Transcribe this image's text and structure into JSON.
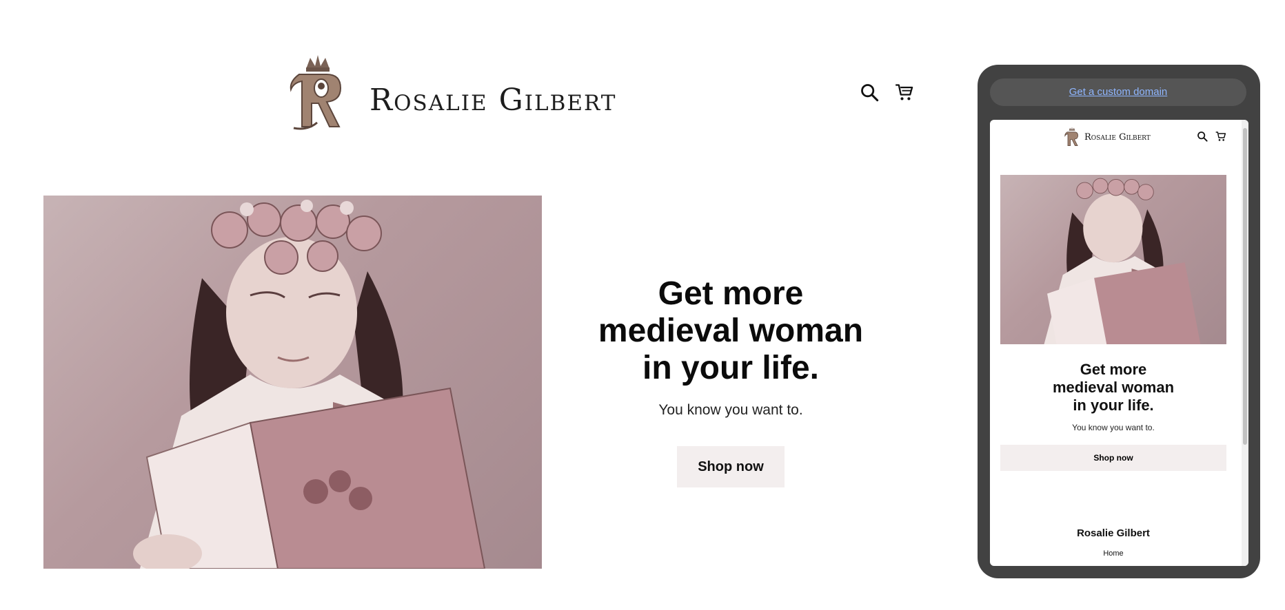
{
  "site": {
    "brand": "Rosalie Gilbert",
    "icons": {
      "search": "search-icon",
      "cart": "cart-icon",
      "monogram": "r-monogram-crown-icon"
    }
  },
  "hero": {
    "title_lines": [
      "Get more",
      "medieval woman",
      "in your life."
    ],
    "subtitle": "You know you want to.",
    "button_label": "Shop now"
  },
  "phone_preview": {
    "domain_link": "Get a custom domain",
    "footer_title": "Rosalie Gilbert",
    "footer_link": "Home"
  },
  "colors": {
    "button_bg": "#f3eeee",
    "phone_frame": "#424242",
    "link": "#8fb6ff",
    "photo_tint": "#b69a9e"
  }
}
